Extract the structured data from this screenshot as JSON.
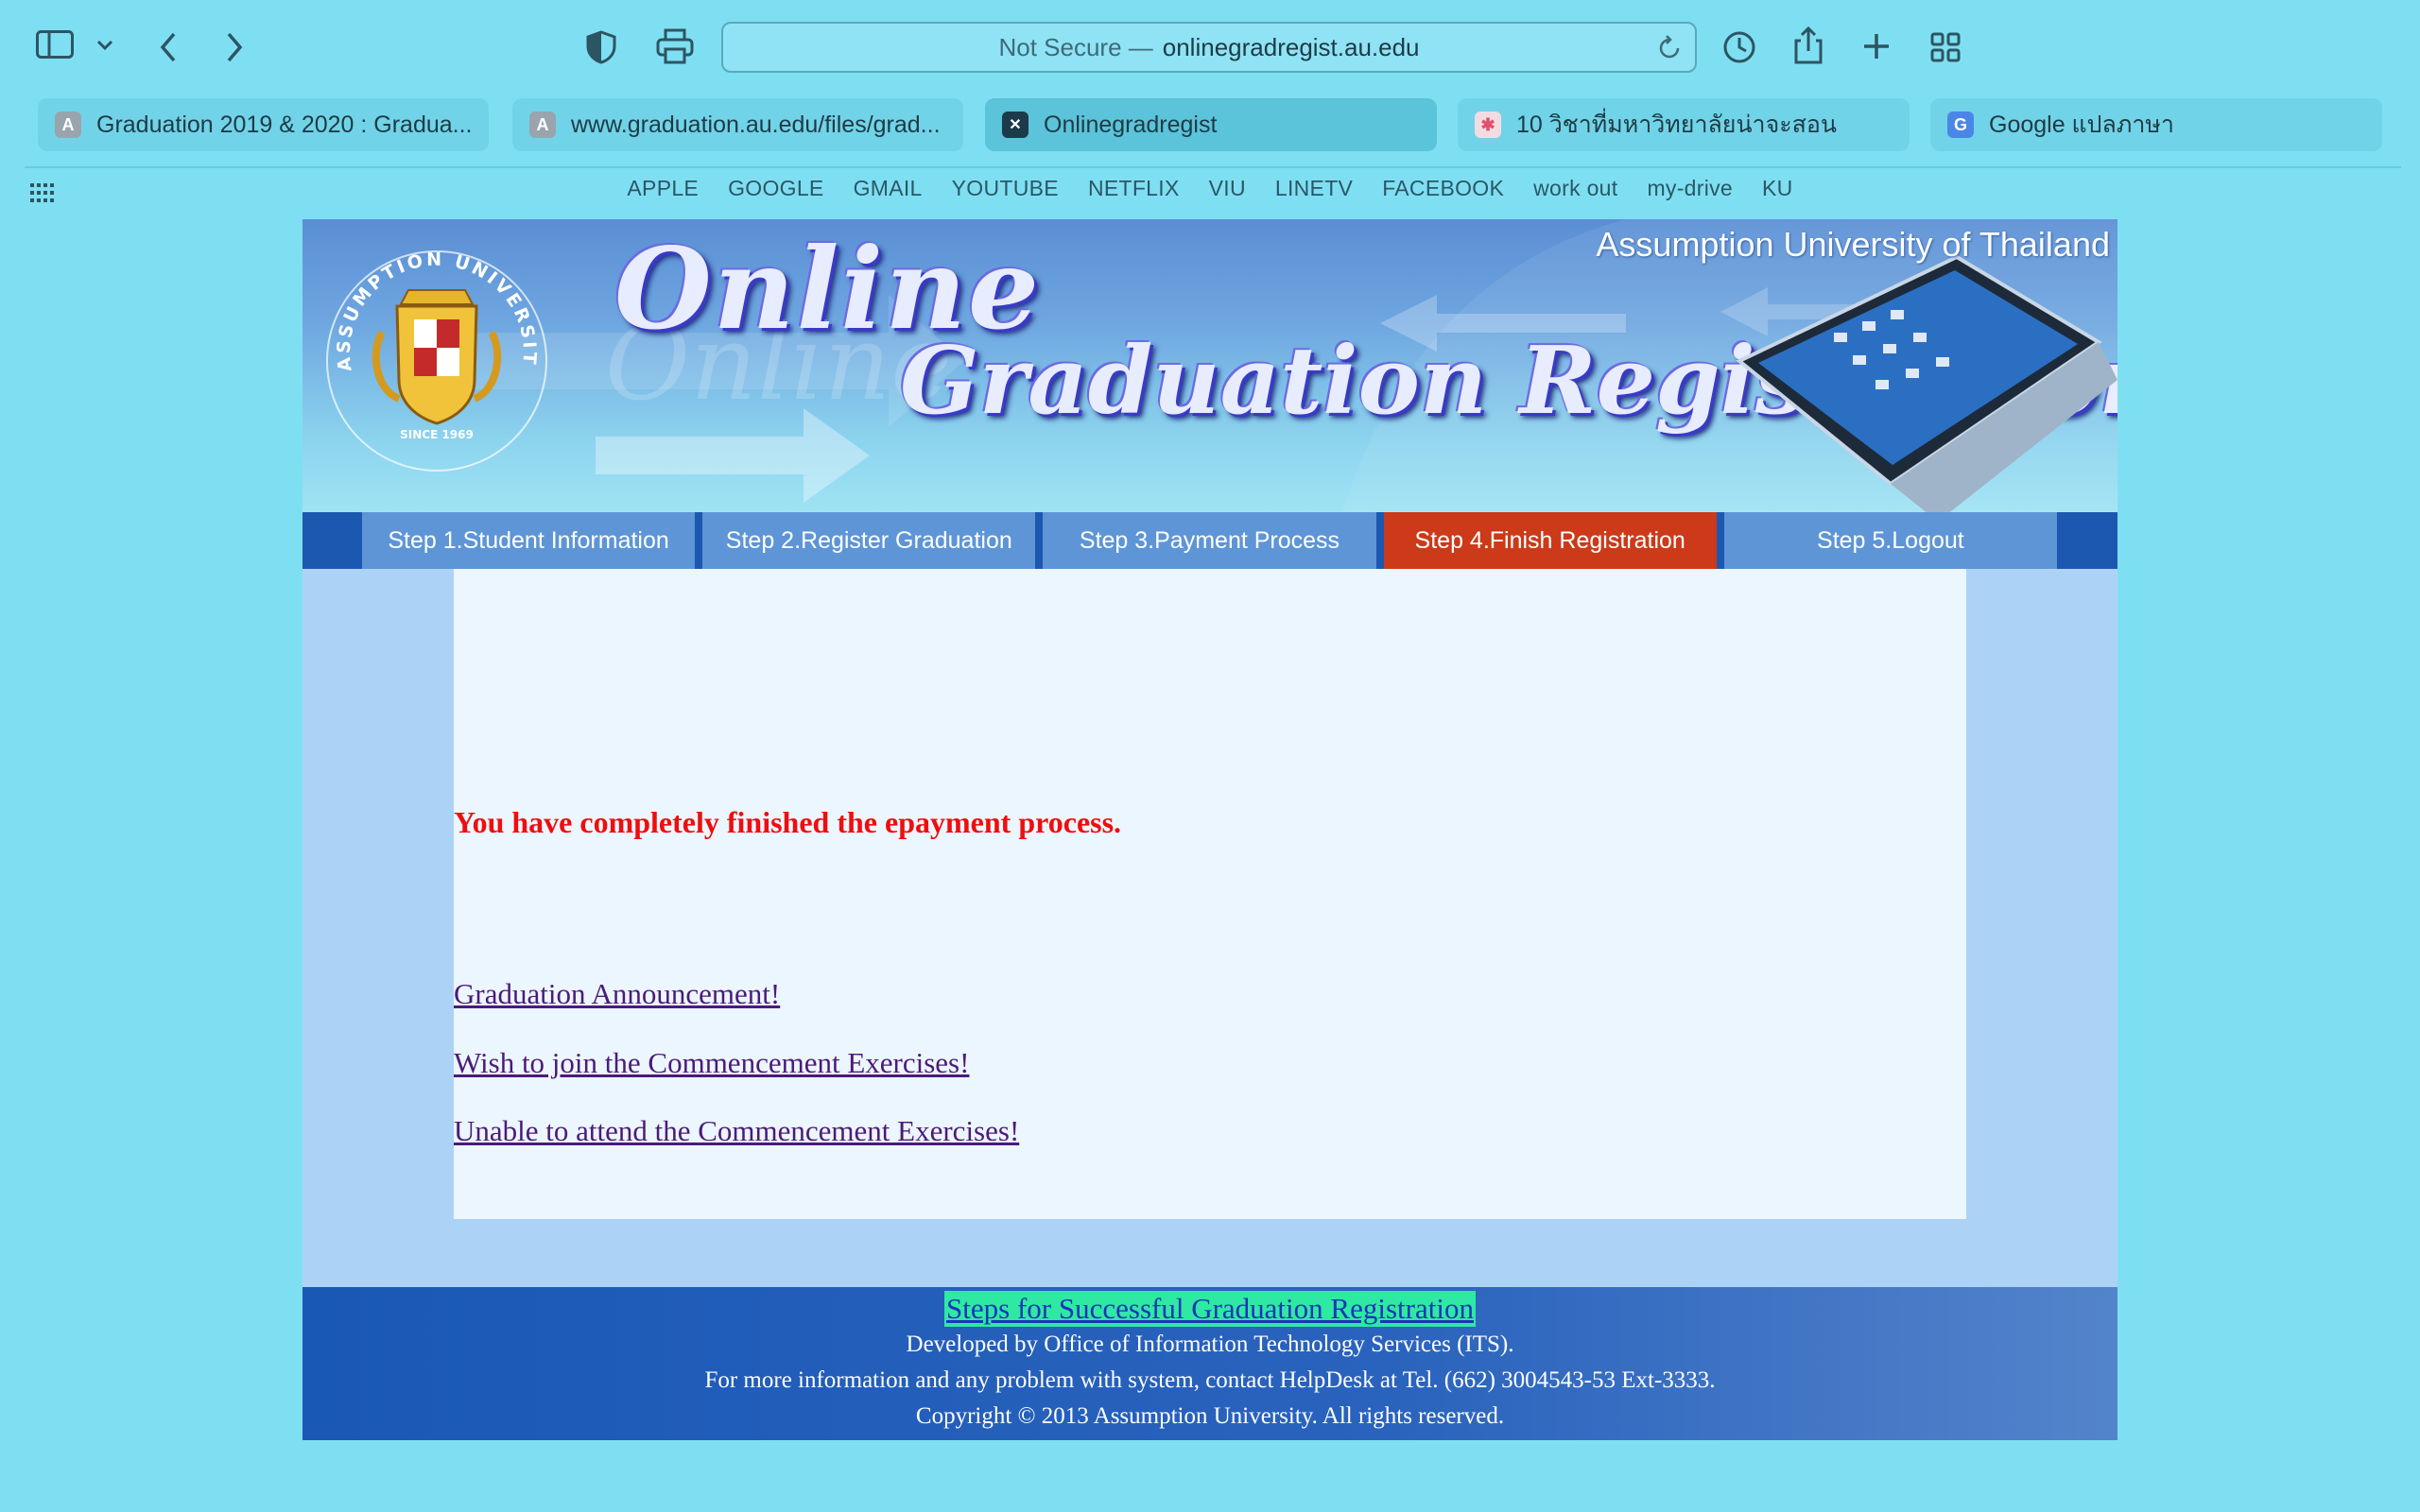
{
  "browser": {
    "url_prefix": "Not Secure —",
    "url_host": "onlinegradregist.au.edu",
    "tabs": [
      {
        "label": "Graduation 2019 & 2020 : Gradua...",
        "favicon": "A",
        "color": "#9aa4ad"
      },
      {
        "label": "www.graduation.au.edu/files/grad...",
        "favicon": "A",
        "color": "#9aa4ad"
      },
      {
        "label": "Onlinegradregist",
        "favicon": "✕",
        "color": "#1b3a4a",
        "active": true
      },
      {
        "label": "10 วิชาที่มหาวิทยาลัยน่าจะสอน",
        "favicon": "✱",
        "color": "#e0506a"
      },
      {
        "label": "Google แปลภาษา",
        "favicon": "G",
        "color": "#4a86e8"
      }
    ],
    "bookmarks": [
      "APPLE",
      "GOOGLE",
      "GMAIL",
      "YOUTUBE",
      "NETFLIX",
      "VIU",
      "LINETV",
      "FACEBOOK",
      "work out",
      "my-drive",
      "KU"
    ]
  },
  "banner": {
    "university": "Assumption University of Thailand",
    "title_line1": "Online",
    "title_line2": "Graduation Registration System"
  },
  "steps": [
    {
      "label": "Step 1.Student Information"
    },
    {
      "label": "Step 2.Register Graduation"
    },
    {
      "label": "Step 3.Payment Process"
    },
    {
      "label": "Step 4.Finish Registration",
      "active": true
    },
    {
      "label": "Step 5.Logout"
    }
  ],
  "content": {
    "message": "You have completely finished the epayment process.",
    "links": [
      "Graduation Announcement!",
      "Wish to join the Commencement Exercises!",
      "Unable to attend the Commencement Exercises!"
    ]
  },
  "footer": {
    "steps_link": "Steps for Successful Graduation Registration",
    "developed_by": "Developed by Office of Information Technology Services (ITS).",
    "contact": "For more information and any problem with system, contact HelpDesk at Tel. (662) 3004543-53 Ext-3333.",
    "copyright": "Copyright © 2013 Assumption University. All rights reserved."
  },
  "colors": {
    "browser_bg": "#7fdff2",
    "active_step": "#cc3a19",
    "step": "#5d95d7",
    "message": "#ee0e0e"
  }
}
